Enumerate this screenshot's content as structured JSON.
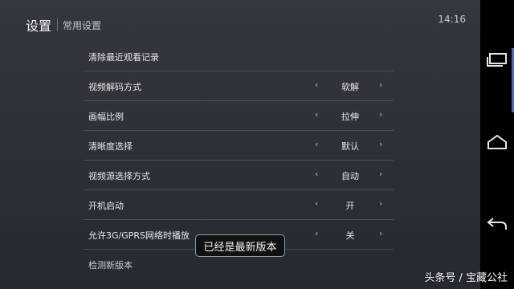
{
  "header": {
    "title": "设置",
    "subtitle": "常用设置"
  },
  "status": {
    "time": "14:16"
  },
  "settings": {
    "rows": [
      {
        "label": "清除最近观看记录"
      },
      {
        "label": "视频解码方式",
        "value": "软解",
        "left": "‹",
        "right": "›"
      },
      {
        "label": "画幅比例",
        "value": "拉伸",
        "left": "‹",
        "right": "›"
      },
      {
        "label": "清晰度选择",
        "value": "默认",
        "left": "‹",
        "right": "›"
      },
      {
        "label": "视频源选择方式",
        "value": "自动",
        "left": "‹",
        "right": "›"
      },
      {
        "label": "开机启动",
        "value": "开",
        "left": "‹",
        "right": "›"
      },
      {
        "label": "允许3G/GPRS网络时播放",
        "value": "关",
        "left": "‹",
        "right": "›"
      },
      {
        "label": "检测新版本"
      }
    ]
  },
  "toast": {
    "message": "已经是最新版本"
  },
  "navbar": {
    "icons": [
      "recent-apps-icon",
      "home-icon",
      "back-icon"
    ]
  },
  "watermark": {
    "text": "头条号 / 宝藏公社"
  }
}
